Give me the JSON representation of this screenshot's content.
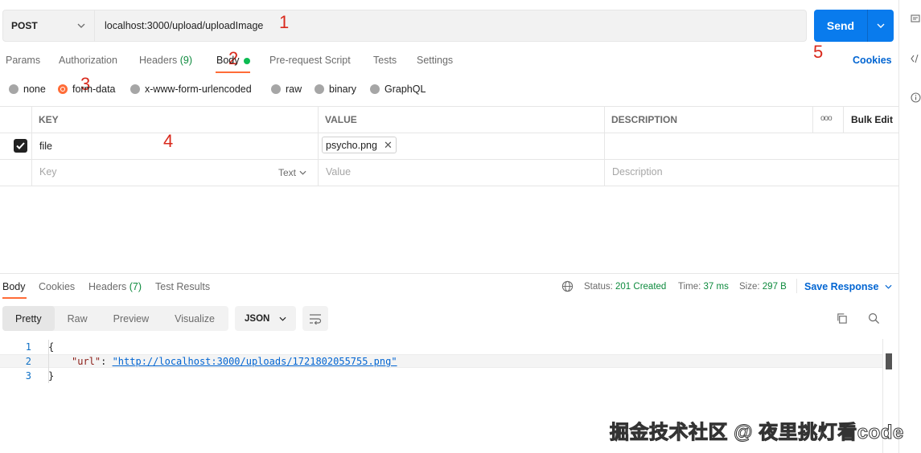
{
  "request": {
    "method": "POST",
    "url": "localhost:3000/upload/uploadImage",
    "send_label": "Send"
  },
  "annotations": [
    "1",
    "2",
    "3",
    "4",
    "5"
  ],
  "request_tabs": [
    {
      "label": "Params"
    },
    {
      "label": "Authorization"
    },
    {
      "label": "Headers",
      "count": "(9)"
    },
    {
      "label": "Body",
      "active": true
    },
    {
      "label": "Pre-request Script"
    },
    {
      "label": "Tests"
    },
    {
      "label": "Settings"
    }
  ],
  "cookies_link": "Cookies",
  "body_types": [
    "none",
    "form-data",
    "x-www-form-urlencoded",
    "raw",
    "binary",
    "GraphQL"
  ],
  "body_selected": "form-data",
  "table": {
    "headers": [
      "KEY",
      "VALUE",
      "DESCRIPTION"
    ],
    "bulk_edit": "Bulk Edit",
    "more": "ooo",
    "rows": [
      {
        "checked": true,
        "key": "file",
        "value": "psycho.png",
        "description": ""
      }
    ],
    "new_row": {
      "key_placeholder": "Key",
      "type_label": "Text",
      "value_placeholder": "Value",
      "description_placeholder": "Description"
    }
  },
  "response_tabs": [
    {
      "label": "Body",
      "active": true
    },
    {
      "label": "Cookies"
    },
    {
      "label": "Headers",
      "count": "(7)"
    },
    {
      "label": "Test Results"
    }
  ],
  "response_meta": {
    "status_label": "Status:",
    "status_value": "201 Created",
    "time_label": "Time:",
    "time_value": "37 ms",
    "size_label": "Size:",
    "size_value": "297 B",
    "save_label": "Save Response"
  },
  "view_modes": [
    "Pretty",
    "Raw",
    "Preview",
    "Visualize"
  ],
  "view_active": "Pretty",
  "format": "JSON",
  "code_lines": [
    {
      "n": "1",
      "text": "{"
    },
    {
      "n": "2",
      "key": "\"url\"",
      "sep": ": ",
      "value": "\"http://localhost:3000/uploads/1721802055755.png\""
    },
    {
      "n": "3",
      "text": "}"
    }
  ],
  "watermark": "掘金技术社区 @ 夜里挑灯看code",
  "icons": [
    "chevron-down-icon",
    "globe-icon",
    "copy-icon",
    "search-icon",
    "wrap-icon",
    "comment-icon",
    "code-icon",
    "info-icon"
  ],
  "colors": {
    "accent": "#ff6c37",
    "send": "#097bed",
    "success": "#0d8a3d",
    "link": "#0265d2",
    "annotation": "#d9291c"
  }
}
